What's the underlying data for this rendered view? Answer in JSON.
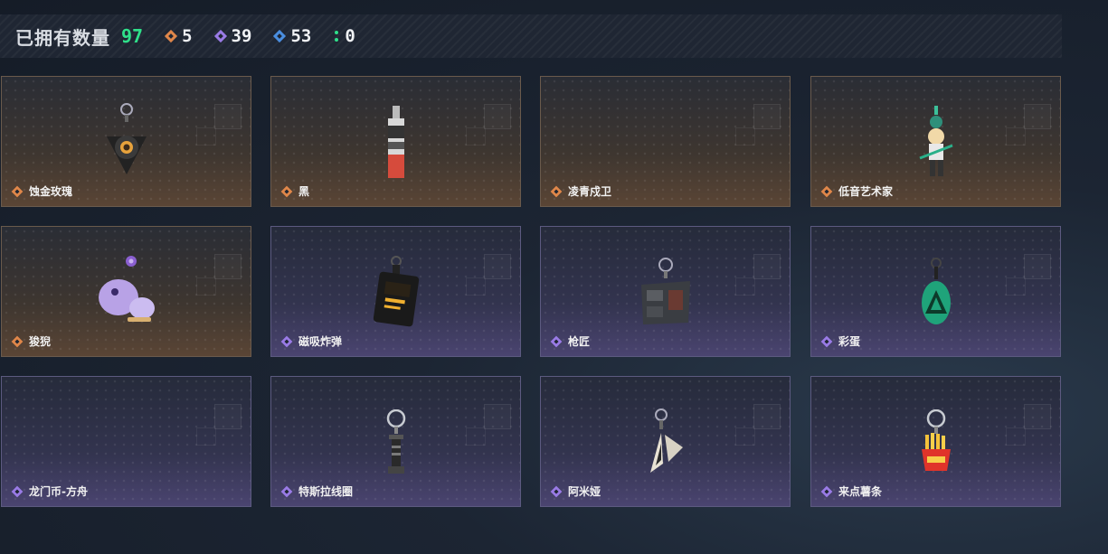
{
  "header": {
    "owned_label": "已拥有数量",
    "owned_count": "97",
    "stats": [
      {
        "rarity": "orange",
        "color": "#e0874a",
        "value": "5"
      },
      {
        "rarity": "purple",
        "color": "#9a7be6",
        "value": "39"
      },
      {
        "rarity": "blue",
        "color": "#4a8ee0",
        "value": "53"
      },
      {
        "rarity": "green",
        "color": "#2fe08a",
        "value": "0"
      }
    ]
  },
  "items": [
    {
      "name": "蚀金玫瑰",
      "rarity": "orange",
      "icon": "gold-rose-charm-icon"
    },
    {
      "name": "黑",
      "rarity": "orange",
      "icon": "black-tube-charm-icon"
    },
    {
      "name": "凌青戍卫",
      "rarity": "orange",
      "icon": ""
    },
    {
      "name": "低音艺术家",
      "rarity": "orange",
      "icon": "bass-artist-figure-charm-icon"
    },
    {
      "name": "狻猊",
      "rarity": "orange",
      "icon": "purple-lion-charm-icon"
    },
    {
      "name": "磁吸炸弹",
      "rarity": "purple",
      "icon": "magnetic-bomb-charm-icon"
    },
    {
      "name": "枪匠",
      "rarity": "purple",
      "icon": "gunsmith-box-charm-icon"
    },
    {
      "name": "彩蛋",
      "rarity": "purple",
      "icon": "green-egg-charm-icon"
    },
    {
      "name": "龙门币-方舟",
      "rarity": "purple",
      "icon": ""
    },
    {
      "name": "特斯拉线圈",
      "rarity": "purple",
      "icon": "tesla-coil-charm-icon"
    },
    {
      "name": "阿米娅",
      "rarity": "purple",
      "icon": "amiya-ears-charm-icon"
    },
    {
      "name": "来点薯条",
      "rarity": "purple",
      "icon": "fries-charm-icon"
    }
  ],
  "colors": {
    "orange": "#e0874a",
    "purple": "#9a7be6",
    "blue": "#4a8ee0",
    "green": "#2fe08a"
  }
}
